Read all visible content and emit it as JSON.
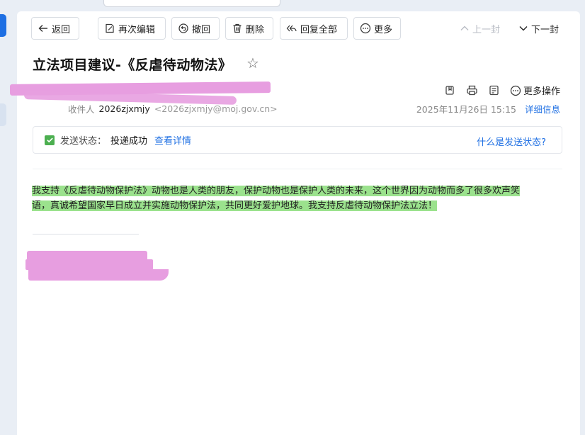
{
  "toolbar": {
    "back": "返回",
    "reedit": "再次编辑",
    "recall": "撤回",
    "delete": "删除",
    "reply_all": "回复全部",
    "more": "更多",
    "prev": "上一封",
    "next": "下一封"
  },
  "mail": {
    "subject": "立法项目建议-《反虐待动物法》",
    "actions": {
      "more_ops": "更多操作"
    },
    "recipient": {
      "label": "收件人",
      "name": "2026zjxmjy",
      "email": "<2026zjxmjy@moj.gov.cn>"
    },
    "date": "2025年11月26日 15:15",
    "detail": "详细信息",
    "status": {
      "label": "发送状态：",
      "value": "投递成功",
      "view": "查看详情",
      "help": "什么是发送状态?"
    },
    "body_line1": "我支持《反虐待动物保护法》动物也是人类的朋友，保护动物也是保护人类的未来，这个世界因为动物而多了很多欢声笑",
    "body_line2": "语，真诚希望国家早日成立并实施动物保护法，共同更好爱护地球。我支持反虐待动物保护法立法！"
  },
  "colors": {
    "accent": "#1e6fe3",
    "highlight": "#9be28d",
    "success": "#4caf50",
    "redaction": "#e79ee0"
  }
}
